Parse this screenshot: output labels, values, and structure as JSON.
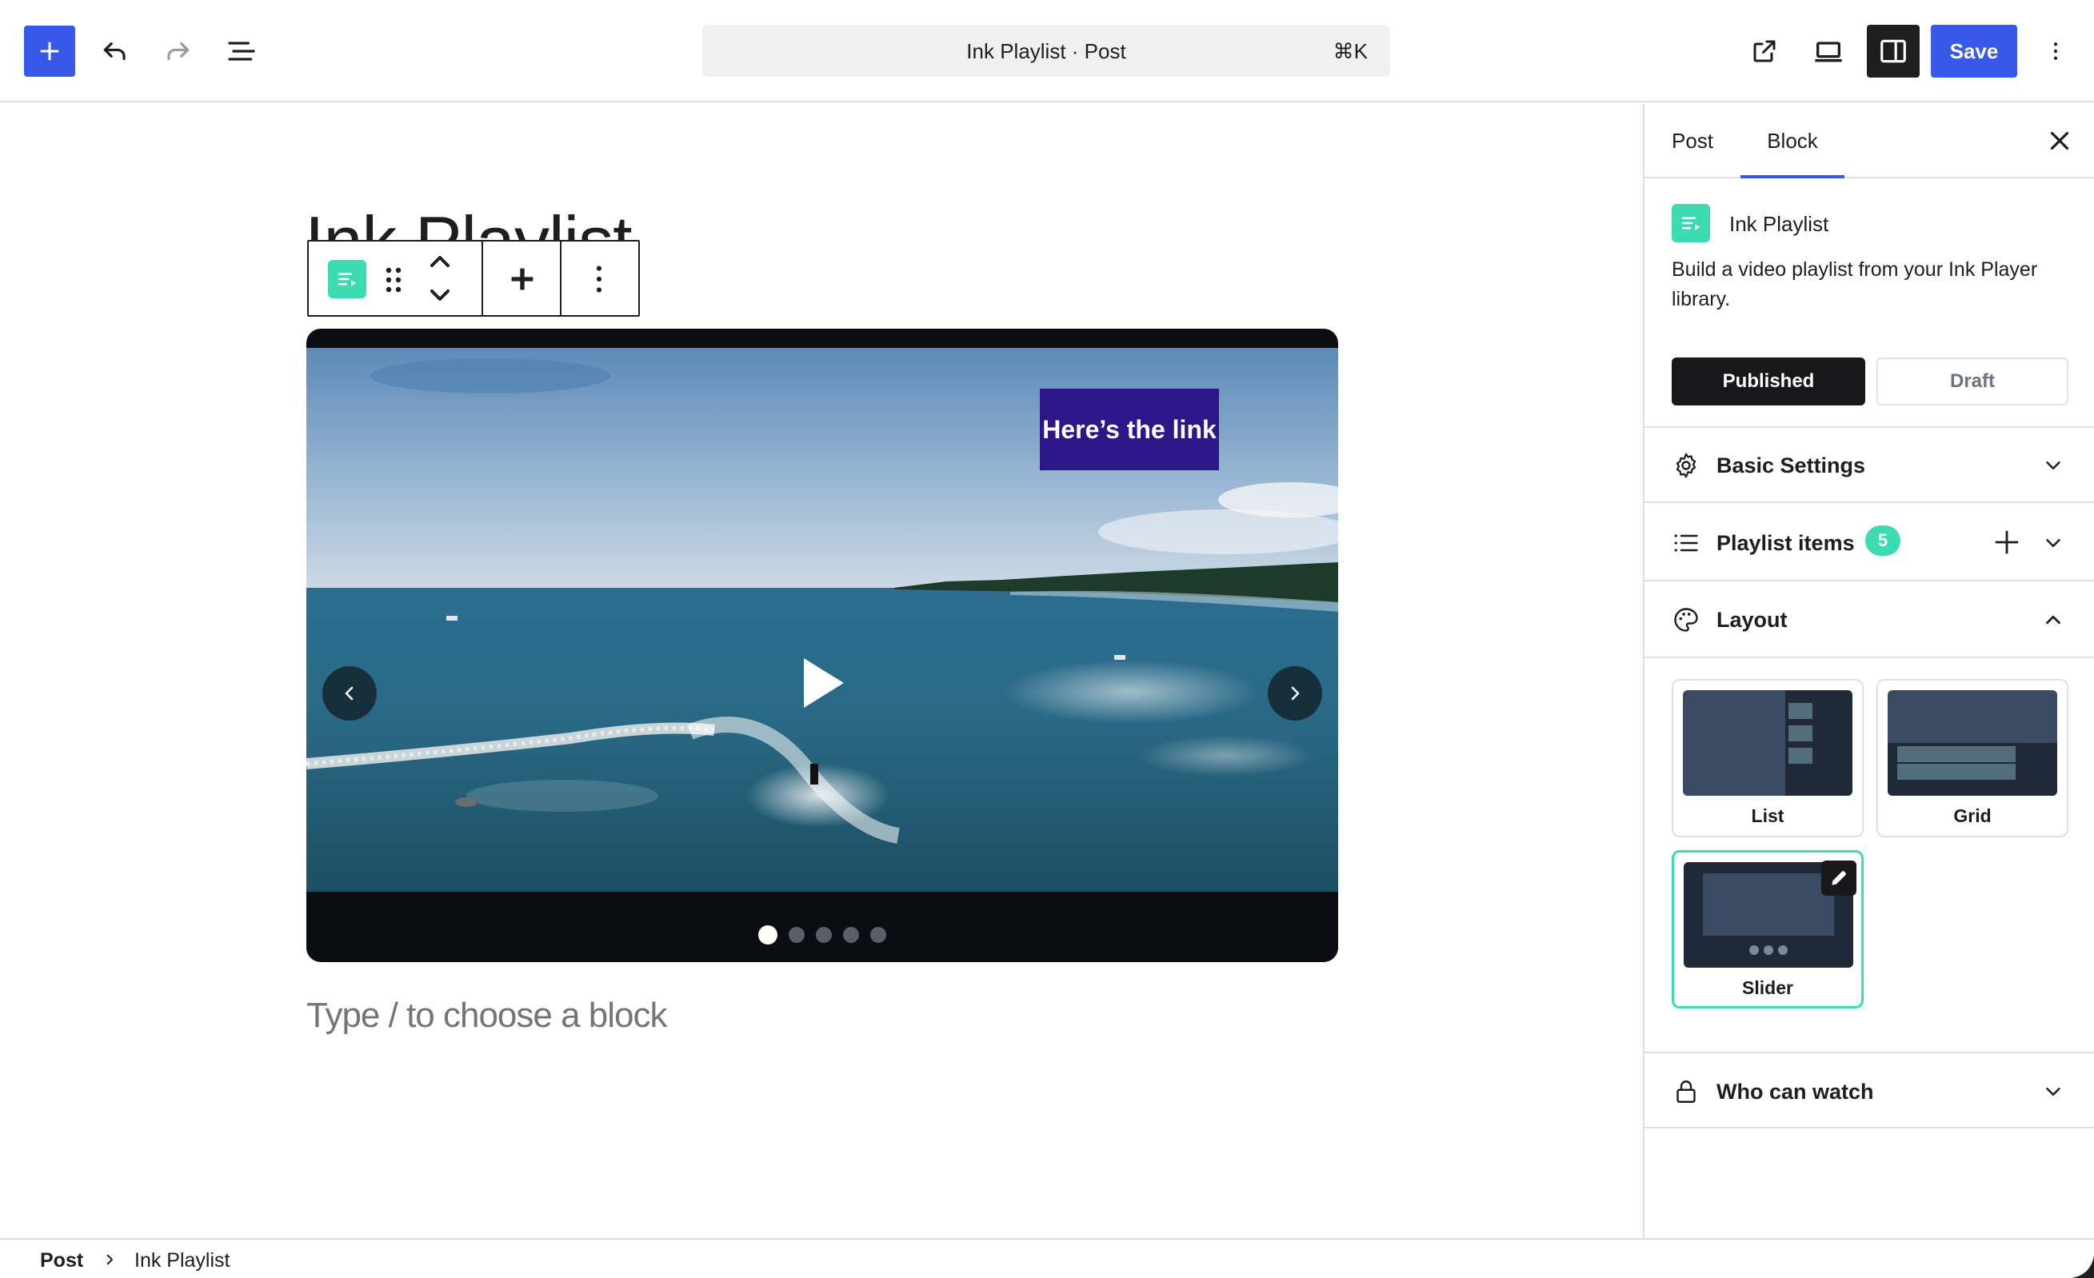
{
  "toolbar": {
    "document_title": "Ink Playlist · Post",
    "shortcut": "⌘K",
    "save_label": "Save",
    "accent_color": "#3858e9"
  },
  "canvas": {
    "post_title": "Ink Playlist",
    "video_link_label": "Here’s the link",
    "slider_page_count": 5,
    "slider_active_page": 1,
    "block_placeholder": "Type / to choose a block"
  },
  "sidebar": {
    "tabs": [
      {
        "label": "Post",
        "active": false
      },
      {
        "label": "Block",
        "active": true
      }
    ],
    "block": {
      "name": "Ink Playlist",
      "description": "Build a video playlist from your Ink Player library.",
      "status_options": [
        "Published",
        "Draft"
      ],
      "selected_status": "Published",
      "brand_color": "#3ddbb1"
    },
    "panels": {
      "basic_settings": "Basic Settings",
      "playlist_items": "Playlist items",
      "playlist_items_count": "5",
      "layout": "Layout",
      "who_can_watch": "Who can watch"
    },
    "layout_options": [
      {
        "label": "List",
        "selected": false
      },
      {
        "label": "Grid",
        "selected": false
      },
      {
        "label": "Slider",
        "selected": true
      }
    ]
  },
  "breadcrumb": {
    "items": [
      "Post",
      "Ink Playlist"
    ]
  }
}
